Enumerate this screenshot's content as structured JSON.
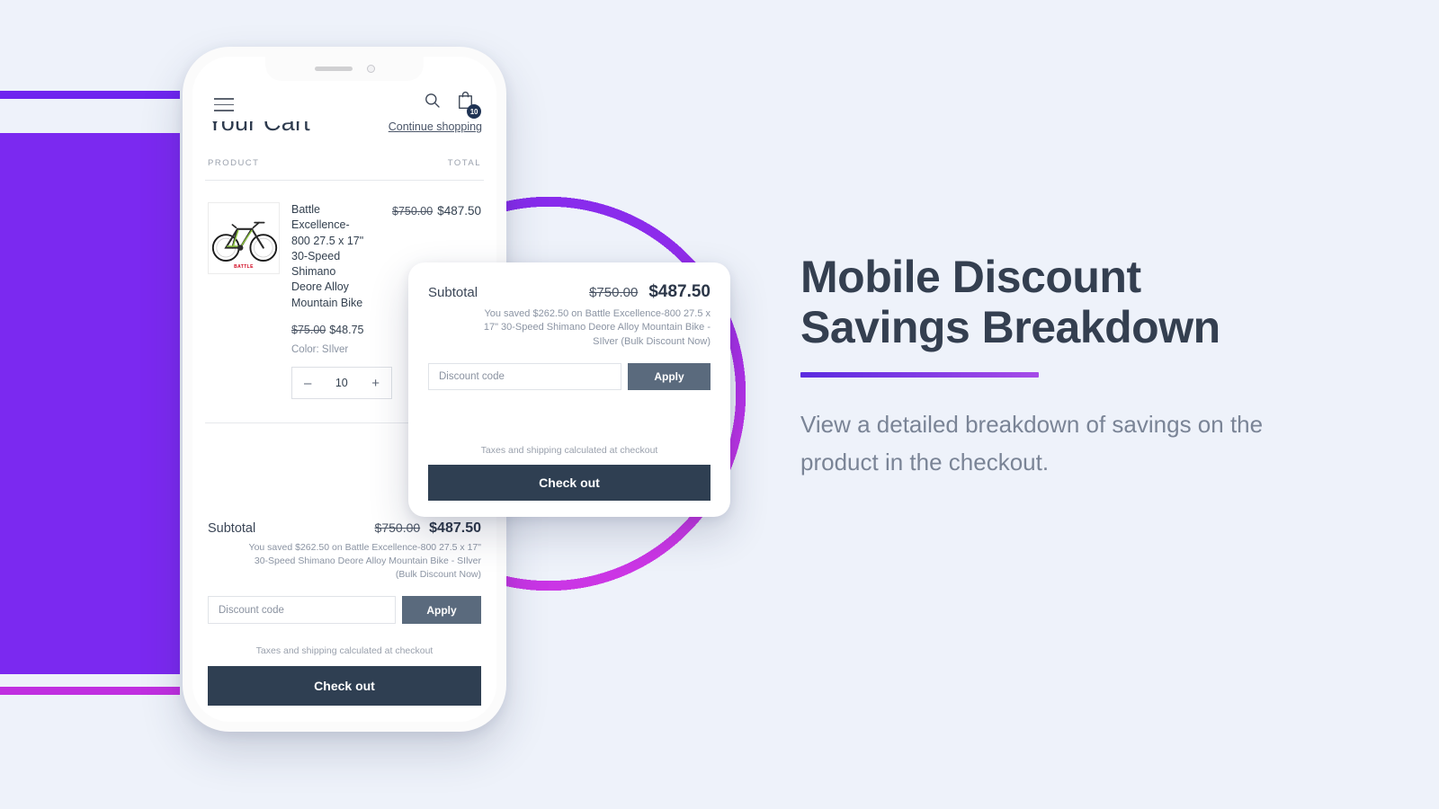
{
  "page": {
    "background_color": "#eef2fa"
  },
  "decor": {
    "purple_block_color": "#7b29f0",
    "line_top_color": "#6f25ef",
    "line_bottom_color": "#c02fe0",
    "ring_gradient_from": "#7b29f0",
    "ring_gradient_to": "#e33ce0"
  },
  "phone": {
    "header": {
      "menu_icon": "hamburger-icon",
      "search_icon": "search-icon",
      "cart_icon": "shopping-bag-icon",
      "cart_count": "10"
    },
    "cart": {
      "title": "Your Cart",
      "continue_link": "Continue shopping",
      "col_product": "PRODUCT",
      "col_total": "TOTAL",
      "item": {
        "image_alt": "mountain-bike-thumbnail",
        "brand_logo": "BATTLE",
        "name": "Battle Excellence-800 27.5 x 17\" 30-Speed Shimano Deore Alloy Mountain Bike",
        "unit_price_original": "$75.00",
        "unit_price_discounted": "$48.75",
        "variant": "Color: SIlver",
        "qty_decrease": "–",
        "qty_value": "10",
        "qty_increase": "+",
        "line_total_original": "$750.00",
        "line_total_discounted": "$487.50"
      },
      "summary": {
        "label": "Subtotal",
        "original": "$750.00",
        "discounted": "$487.50",
        "saved_note": "You saved $262.50 on Battle Excellence-800 27.5 x 17\" 30-Speed Shimano Deore Alloy Mountain Bike - SIlver (Bulk Discount Now)",
        "discount_placeholder": "Discount code",
        "apply_label": "Apply",
        "taxes_note": "Taxes and shipping calculated at checkout",
        "checkout_label": "Check out"
      }
    }
  },
  "popup": {
    "label": "Subtotal",
    "original": "$750.00",
    "discounted": "$487.50",
    "saved_note": "You saved $262.50 on Battle Excellence-800 27.5 x 17\" 30-Speed Shimano Deore Alloy Mountain Bike - SIlver (Bulk Discount Now)",
    "discount_placeholder": "Discount code",
    "apply_label": "Apply",
    "taxes_note": "Taxes and shipping calculated at checkout",
    "checkout_label": "Check out"
  },
  "copy": {
    "heading_line1": "Mobile Discount",
    "heading_line2": "Savings Breakdown",
    "body": "View a detailed breakdown of savings on the product in the checkout.",
    "accent_from": "#5b2be0",
    "accent_to": "#a64be8"
  }
}
